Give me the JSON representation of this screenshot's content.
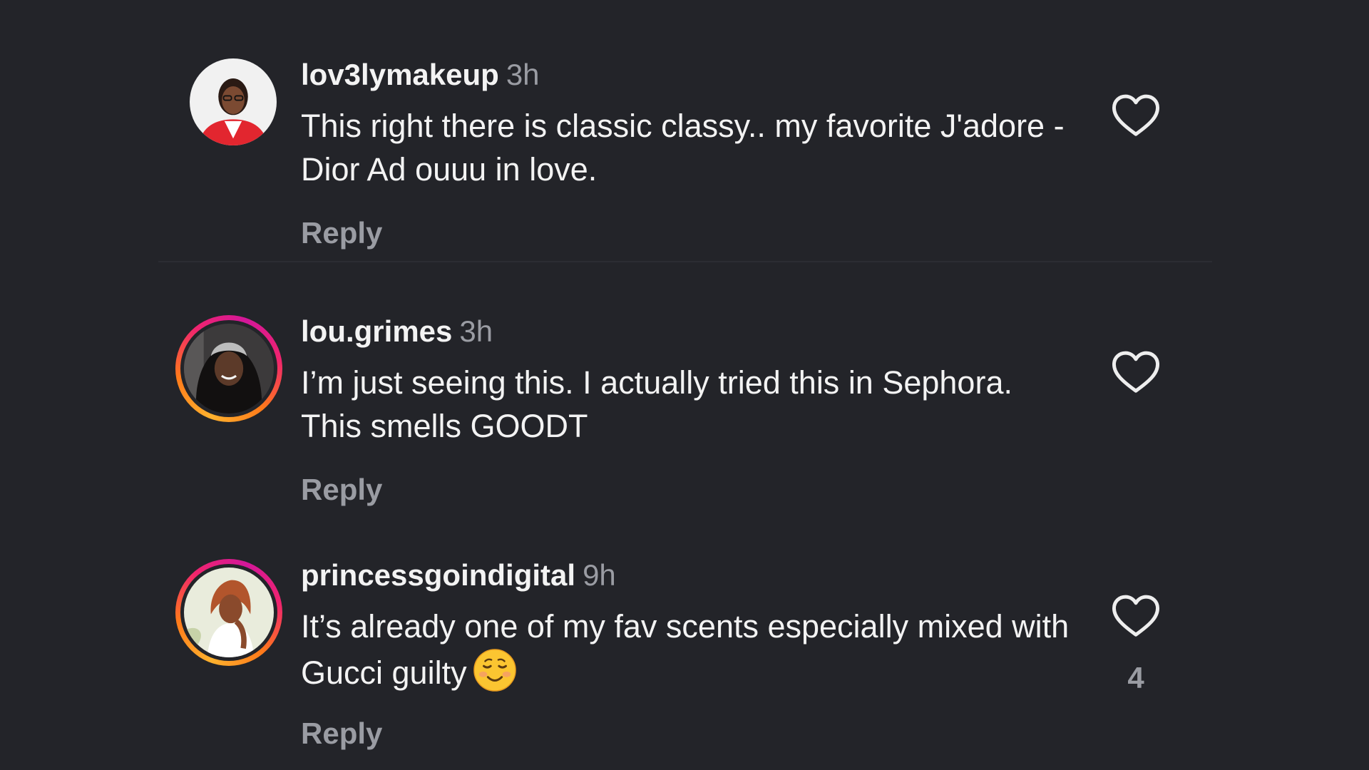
{
  "comments": [
    {
      "username": "lov3lymakeup",
      "time": "3h",
      "text": "This right there is classic classy.. my favorite J'adore - Dior Ad ouuu in love.",
      "reply_label": "Reply",
      "has_story": false
    },
    {
      "username": "lou.grimes",
      "time": "3h",
      "text": "I’m just seeing this. I actually tried this in Sephora. This smells GOODT",
      "reply_label": "Reply",
      "has_story": true
    },
    {
      "username": "princessgoindigital",
      "time": "9h",
      "text": "It’s already one of my fav scents especially mixed with Gucci guilty",
      "emoji": "☺️",
      "reply_label": "Reply",
      "like_count": "4",
      "has_story": true
    }
  ],
  "icons": {
    "like": "heart-outline-icon",
    "emoji": "smiling-face-emoji-icon"
  },
  "colors": {
    "background": "#232429",
    "text": "#f3f3f3",
    "muted": "#9a9ca3",
    "story_ring": [
      "#ffb22e",
      "#ff7a1a",
      "#f0246e",
      "#d3179a"
    ]
  }
}
